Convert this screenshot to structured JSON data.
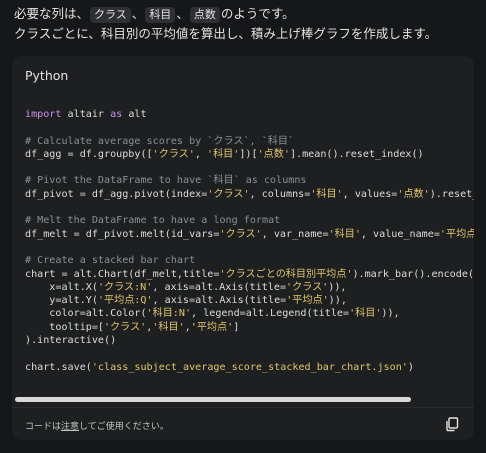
{
  "intro": {
    "line1_prefix": "必要な列は、",
    "chip1": "クラス",
    "sep1": "、",
    "chip2": "科目",
    "sep2": "、",
    "chip3": "点数",
    "line1_suffix": "のようです。",
    "line2": "クラスごとに、科目別の平均値を算出し、積み上げ棒グラフを作成します。"
  },
  "code_block": {
    "language": "Python",
    "l_import_kw": "import",
    "l_import_mod": " altair ",
    "l_import_as": "as",
    "l_import_alias": " alt",
    "c1": "# Calculate average scores by `クラス`, `科目`",
    "l_agg_a": "df_agg = df.groupby([",
    "s_class": "'クラス'",
    "comma": ", ",
    "s_subject": "'科目'",
    "l_agg_b": "])[",
    "s_score": "'点数'",
    "l_agg_c": "].mean().reset_index()",
    "c2": "# Pivot the DataFrame to have `科目` as columns",
    "l_pivot_a": "df_pivot = df_agg.pivot(index=",
    "l_pivot_b": ", columns=",
    "l_pivot_c": ", values=",
    "l_pivot_d": ").reset_index()",
    "c3": "# Melt the DataFrame to have a long format",
    "l_melt_a": "df_melt = df_pivot.melt(id_vars=",
    "l_melt_b": ", var_name=",
    "l_melt_c": ", value_name=",
    "s_avg_cut": "'平均点'",
    "c4": "# Create a stacked bar chart",
    "l_chart_a": "chart = alt.Chart(df_melt,title=",
    "s_title": "'クラスごとの科目別平均点'",
    "l_chart_b": ").mark_bar().encode(",
    "l_x_a": "    x=alt.X(",
    "s_x": "'クラス:N'",
    "l_x_b": ", axis=alt.Axis(title=",
    "l_close2": ")),",
    "l_y_a": "    y=alt.Y(",
    "s_y": "'平均点:Q'",
    "s_avg": "'平均点'",
    "l_color_a": "    color=alt.Color(",
    "s_color": "'科目:N'",
    "l_color_b": ", legend=alt.Legend(title=",
    "l_tooltip_a": "    tooltip=[",
    "l_tooltip_comma": ",",
    "l_tooltip_b": "]",
    "l_interactive": ").interactive()",
    "l_save_a": "chart.save(",
    "s_file": "'class_subject_average_score_stacked_bar_chart.json'",
    "l_save_b": ")"
  },
  "footer": {
    "prefix": "コードは",
    "link": "注意",
    "suffix": "してご使用ください。",
    "copy_icon": "copy-icon"
  },
  "colors": {
    "background": "#161719",
    "card": "#1e1f20",
    "keyword": "#c792ea",
    "string": "#e0c56c",
    "comment": "#8a8f98"
  }
}
